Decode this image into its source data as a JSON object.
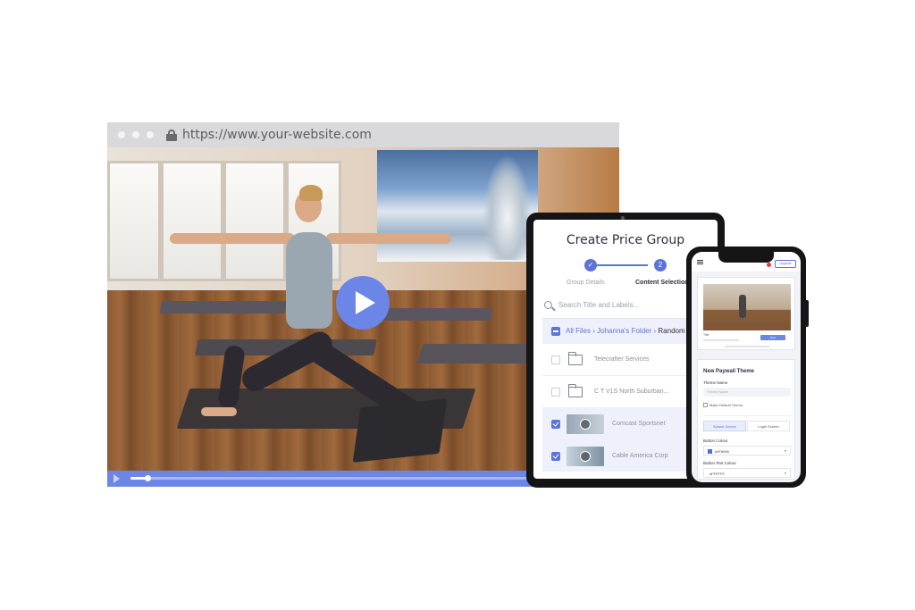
{
  "browser": {
    "url": "https://www.your-website.com",
    "video_progress": 0.04
  },
  "tablet": {
    "title": "Create Price Group",
    "steps": [
      {
        "label": "Group Details",
        "marker": "✓"
      },
      {
        "label": "Content Selection",
        "marker": "2"
      }
    ],
    "search_placeholder": "Search Title and Labels...",
    "breadcrumb": {
      "root": "All Files",
      "folder": "Johanna's Folder",
      "current": "Random"
    },
    "rows": [
      {
        "label": "Telecrafter Services"
      },
      {
        "label": "C T V1S North Suburban..."
      },
      {
        "label": "Comcast Sportsnet"
      },
      {
        "label": "Cable America Corp"
      }
    ]
  },
  "phone": {
    "header_button": "Upgrade",
    "preview": {
      "title_label": "Title",
      "button_label": "Next"
    },
    "form": {
      "heading": "New Paywall Theme",
      "theme_name_label": "Theme Name",
      "theme_name_placeholder": "Theme Name",
      "default_checkbox_label": "Make Default Theme",
      "tabs": [
        "Splash Screen",
        "Login Screen"
      ],
      "button_colour_label": "Button Colour",
      "button_colour_value": "#4F8066",
      "button_text_colour_label": "Button Text Colour",
      "button_text_colour_value": "#FFFFFF"
    }
  },
  "colors": {
    "accent": "#6B86E6",
    "primary": "#5B74D6",
    "swatch": "#4A72D8",
    "notification": "#E33B45"
  }
}
